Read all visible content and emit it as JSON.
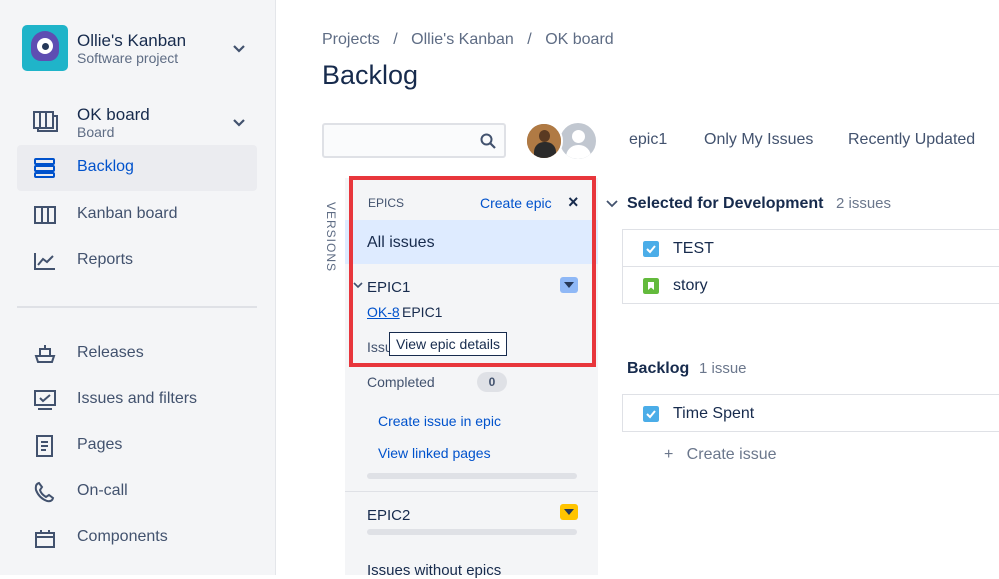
{
  "project": {
    "name": "Ollie's Kanban",
    "type": "Software project"
  },
  "board": {
    "name": "OK board",
    "type": "Board"
  },
  "nav": {
    "items": [
      {
        "label": "Backlog",
        "icon": "backlog-icon",
        "active": true
      },
      {
        "label": "Kanban board",
        "icon": "kanban-board-icon"
      },
      {
        "label": "Reports",
        "icon": "reports-icon"
      }
    ],
    "secondary": [
      {
        "label": "Releases",
        "icon": "releases-icon"
      },
      {
        "label": "Issues and filters",
        "icon": "issues-filters-icon"
      },
      {
        "label": "Pages",
        "icon": "pages-icon"
      },
      {
        "label": "On-call",
        "icon": "on-call-icon"
      },
      {
        "label": "Components",
        "icon": "components-icon"
      }
    ]
  },
  "breadcrumb": [
    "Projects",
    "/",
    "Ollie's Kanban",
    "/",
    "OK board"
  ],
  "page_title": "Backlog",
  "search": {
    "placeholder": "",
    "value": ""
  },
  "quick_filters": [
    "epic1",
    "Only My Issues",
    "Recently Updated"
  ],
  "versions_tab": "VERSIONS",
  "epics_panel": {
    "header": "EPICS",
    "create_label": "Create epic",
    "close_glyph": "×",
    "all_issues": "All issues",
    "epic1": {
      "name": "EPIC1",
      "key": "OK-8",
      "key_title": "EPIC1",
      "issues_label": "Issu",
      "completed_label": "Completed",
      "completed_count": "0",
      "create_issue": "Create issue in epic",
      "view_pages": "View linked pages",
      "color": "#8FB8F6"
    },
    "epic2": {
      "name": "EPIC2",
      "color": "#FFC400"
    },
    "without_epics": "Issues without epics",
    "tooltip": "View epic details"
  },
  "selected_for_dev": {
    "title": "Selected for Development",
    "count": "2 issues",
    "issues": [
      {
        "summary": "TEST",
        "type": "task"
      },
      {
        "summary": "story",
        "type": "story"
      }
    ]
  },
  "backlog": {
    "title": "Backlog",
    "count": "1 issue",
    "issues": [
      {
        "summary": "Time Spent",
        "type": "task"
      }
    ],
    "create_issue": "+   Create issue"
  },
  "colors": {
    "accent": "#0052CC",
    "highlight": "#E8363C",
    "task": "#4BADE8",
    "story": "#63BA3C"
  }
}
